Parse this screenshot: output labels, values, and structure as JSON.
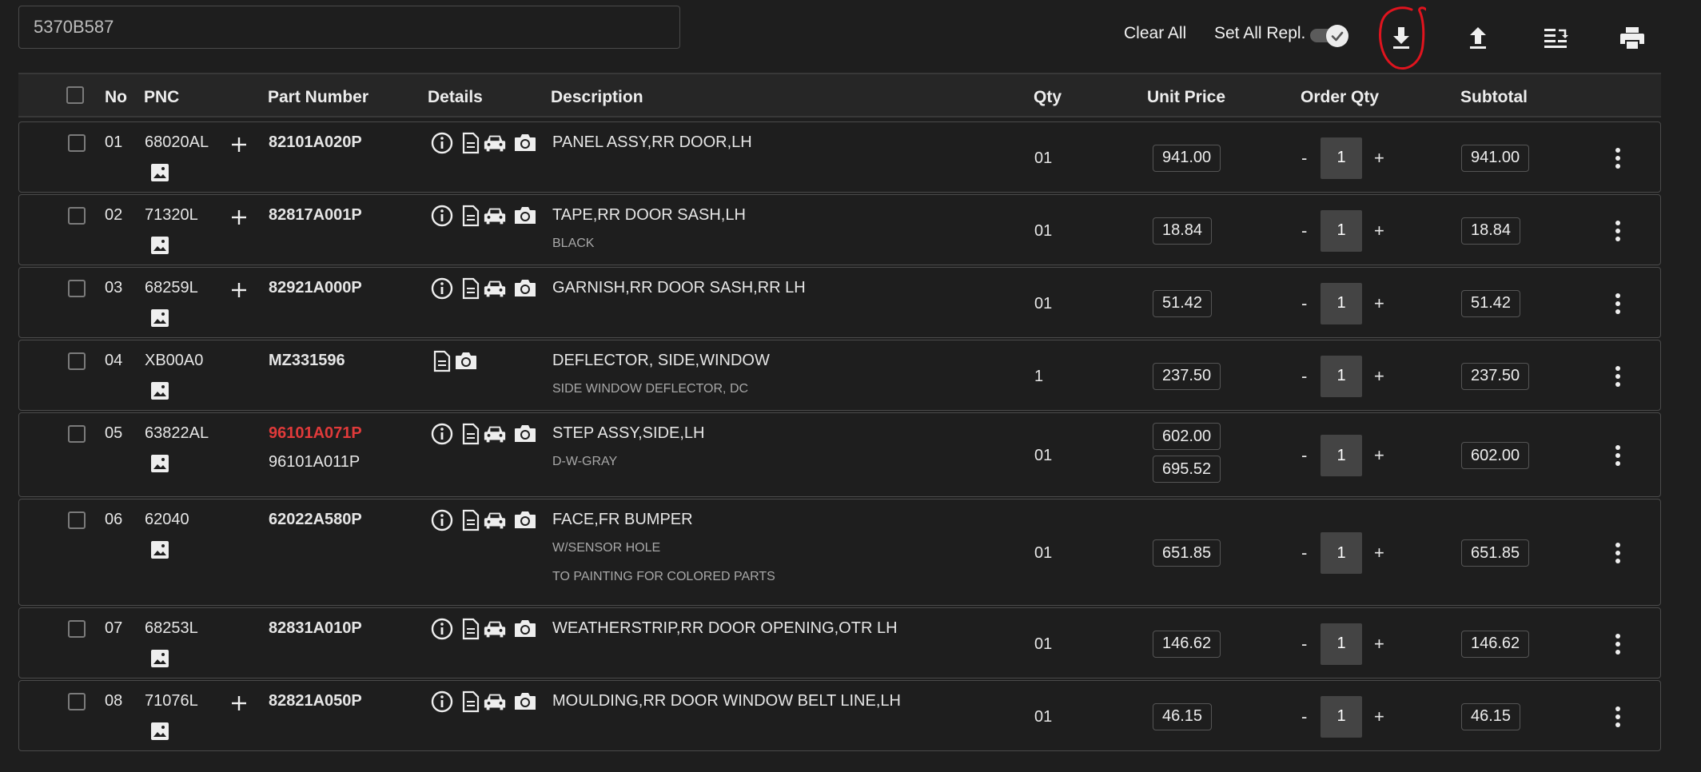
{
  "search": {
    "value": "5370B587"
  },
  "toolbar": {
    "clear_all": "Clear All",
    "set_all_repl": "Set All Repl.",
    "set_all_repl_on": true,
    "icons": [
      "download-icon",
      "upload-icon",
      "replace-list-icon",
      "print-icon"
    ]
  },
  "table": {
    "headers": {
      "no": "No",
      "pnc": "PNC",
      "part_number": "Part Number",
      "details": "Details",
      "description": "Description",
      "qty": "Qty",
      "unit_price": "Unit Price",
      "order_qty": "Order Qty",
      "subtotal": "Subtotal"
    },
    "minus": "-",
    "plus": "+",
    "rows": [
      {
        "no": "01",
        "pnc": "68020AL",
        "part": "82101A020P",
        "desc": "PANEL ASSY,RR DOOR,LH",
        "qty": "01",
        "price": "941.00",
        "order_qty": "1",
        "subtotal": "941.00"
      },
      {
        "no": "02",
        "pnc": "71320L",
        "part": "82817A001P",
        "desc": "TAPE,RR DOOR SASH,LH",
        "sub1": "BLACK",
        "qty": "01",
        "price": "18.84",
        "order_qty": "1",
        "subtotal": "18.84"
      },
      {
        "no": "03",
        "pnc": "68259L",
        "part": "82921A000P",
        "desc": "GARNISH,RR DOOR SASH,RR LH",
        "qty": "01",
        "price": "51.42",
        "order_qty": "1",
        "subtotal": "51.42"
      },
      {
        "no": "04",
        "pnc": "XB00A0",
        "part": "MZ331596",
        "desc": "DEFLECTOR, SIDE,WINDOW",
        "sub1": "SIDE WINDOW DEFLECTOR, DC",
        "qty": "1",
        "price": "237.50",
        "order_qty": "1",
        "subtotal": "237.50"
      },
      {
        "no": "05",
        "pnc": "63822AL",
        "part": "96101A071P",
        "alt_part": "96101A011P",
        "desc": "STEP ASSY,SIDE,LH",
        "sub1": "D-W-GRAY",
        "qty": "01",
        "price": "602.00",
        "alt_price": "695.52",
        "order_qty": "1",
        "subtotal": "602.00"
      },
      {
        "no": "06",
        "pnc": "62040",
        "part": "62022A580P",
        "desc": "FACE,FR BUMPER",
        "sub1": "W/SENSOR HOLE",
        "sub2": "TO PAINTING FOR COLORED PARTS",
        "qty": "01",
        "price": "651.85",
        "order_qty": "1",
        "subtotal": "651.85"
      },
      {
        "no": "07",
        "pnc": "68253L",
        "part": "82831A010P",
        "desc": "WEATHERSTRIP,RR DOOR OPENING,OTR LH",
        "qty": "01",
        "price": "146.62",
        "order_qty": "1",
        "subtotal": "146.62"
      },
      {
        "no": "08",
        "pnc": "71076L",
        "part": "82821A050P",
        "desc": "MOULDING,RR DOOR WINDOW BELT LINE,LH",
        "qty": "01",
        "price": "46.15",
        "order_qty": "1",
        "subtotal": "46.15"
      }
    ]
  },
  "colors": {
    "background": "#1e1e1e",
    "highlight_part": "#e03a3a",
    "annotation": "#e0141e"
  }
}
